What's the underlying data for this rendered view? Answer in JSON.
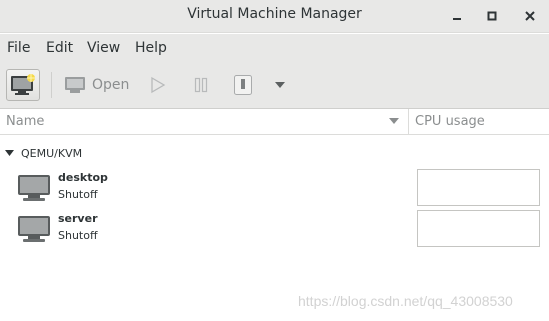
{
  "window": {
    "title": "Virtual Machine Manager",
    "controls": [
      "minimize-icon",
      "maximize-icon",
      "close-icon"
    ]
  },
  "menubar": {
    "items": [
      {
        "label": "File"
      },
      {
        "label": "Edit"
      },
      {
        "label": "View"
      },
      {
        "label": "Help"
      }
    ]
  },
  "toolbar": {
    "new_vm_icon": "new-vm-icon",
    "open_label": "Open",
    "run_icon": "play-icon",
    "pause_icon": "pause-icon",
    "shutdown_icon": "shutdown-icon",
    "menu_icon": "chevron-down-icon"
  },
  "columns": {
    "name": "Name",
    "cpu": "CPU usage"
  },
  "connections": [
    {
      "label": "QEMU/KVM",
      "vms": [
        {
          "name": "desktop",
          "state": "Shutoff"
        },
        {
          "name": "server",
          "state": "Shutoff"
        }
      ]
    }
  ],
  "watermark": "https://blog.csdn.net/qq_43008530",
  "colors": {
    "chrome": "#e8e8e7",
    "text": "#2e3436",
    "muted": "#8b8e8f"
  }
}
